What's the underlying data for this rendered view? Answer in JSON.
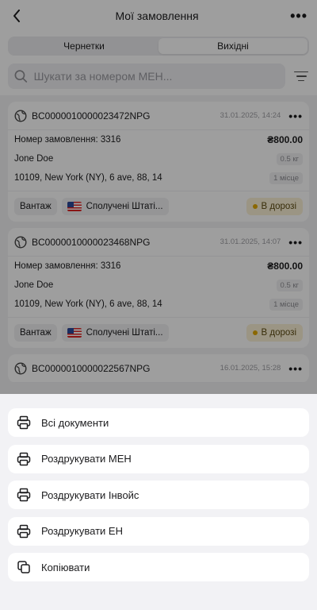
{
  "header": {
    "title": "Мої замовлення"
  },
  "tabs": [
    {
      "label": "Чернетки",
      "active": false
    },
    {
      "label": "Вихідні",
      "active": true
    }
  ],
  "search": {
    "placeholder": "Шукати за номером МЕН..."
  },
  "orders": [
    {
      "code": "BC0000010000023472NPG",
      "date": "31.01.2025, 14:24",
      "order_label": "Номер замовлення: 3316",
      "amount": "₴800.00",
      "name": "Jone Doe",
      "weight": "0.5 кг",
      "address": "10109, New York (NY), 6 ave, 88, 14",
      "places": "1 місце",
      "type": "Вантаж",
      "country": "Сполучені Штаті...",
      "status": "В дорозі"
    },
    {
      "code": "BC0000010000023468NPG",
      "date": "31.01.2025, 14:07",
      "order_label": "Номер замовлення: 3316",
      "amount": "₴800.00",
      "name": "Jone Doe",
      "weight": "0.5 кг",
      "address": "10109, New York (NY), 6 ave, 88, 14",
      "places": "1 місце",
      "type": "Вантаж",
      "country": "Сполучені Штаті...",
      "status": "В дорозі"
    },
    {
      "code": "BC0000010000022567NPG",
      "date": "16.01.2025, 15:28"
    }
  ],
  "sheet": {
    "actions": [
      {
        "label": "Всі документи",
        "icon": "printer-icon"
      },
      {
        "label": "Роздрукувати МЕН",
        "icon": "printer-icon"
      },
      {
        "label": "Роздрукувати Інвойс",
        "icon": "printer-icon"
      },
      {
        "label": "Роздрукувати ЕН",
        "icon": "printer-icon"
      },
      {
        "label": "Копіювати",
        "icon": "copy-icon"
      }
    ]
  },
  "colors": {
    "status_bg": "#fbf1d6",
    "status_dot": "#e0a800",
    "overlay": "rgba(0,0,0,0.38)"
  }
}
